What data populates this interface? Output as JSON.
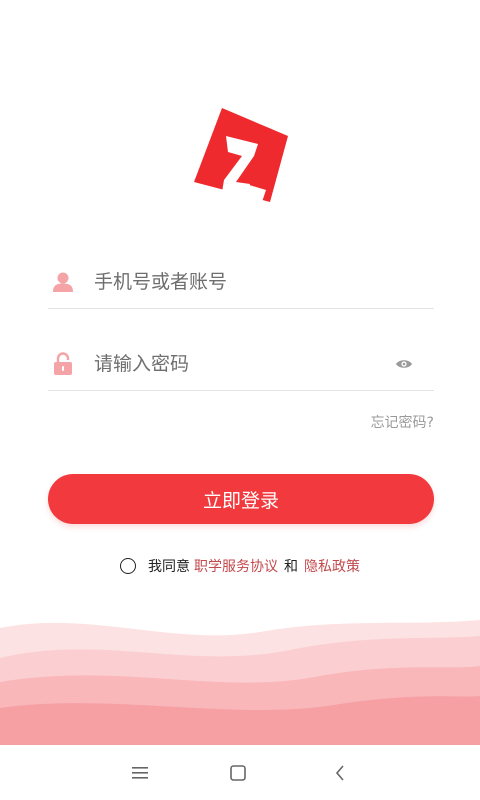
{
  "app": {
    "logo_name": "z-logo",
    "brand_color": "#ee2a2e"
  },
  "login": {
    "account_placeholder": "手机号或者账号",
    "password_placeholder": "请输入密码",
    "forgot_label": "忘记密码?",
    "submit_label": "立即登录"
  },
  "agreement": {
    "checked": false,
    "prefix": "我同意",
    "service_link": "职学服务协议",
    "conjunction": "和",
    "privacy_link": "隐私政策"
  },
  "system_nav": {
    "items": [
      "menu-icon",
      "home-icon",
      "back-icon"
    ]
  }
}
